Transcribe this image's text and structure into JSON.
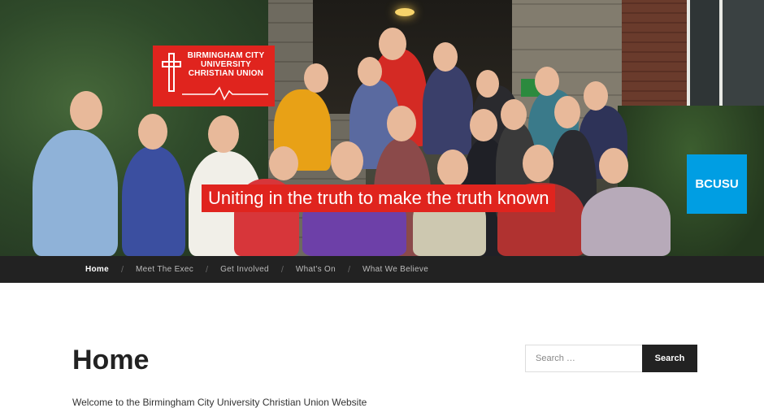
{
  "header": {
    "logo": {
      "lines": [
        "BIRMINGHAM CITY",
        "UNIVERSITY",
        "CHRISTIAN UNION"
      ],
      "background": "#e0241e"
    },
    "tagline": "Uniting in the truth to make the truth known",
    "bcusu_badge": "BCUSU",
    "brand_colors": {
      "red": "#e0241e",
      "blue": "#009ee3"
    }
  },
  "nav": {
    "items": [
      {
        "label": "Home",
        "active": true
      },
      {
        "label": "Meet The Exec",
        "active": false
      },
      {
        "label": "Get Involved",
        "active": false
      },
      {
        "label": "What's On",
        "active": false
      },
      {
        "label": "What We Believe",
        "active": false
      }
    ],
    "separator": "/"
  },
  "main": {
    "title": "Home",
    "intro": "Welcome to the Birmingham City University Christian Union Website"
  },
  "sidebar": {
    "search": {
      "placeholder": "Search …",
      "button_label": "Search"
    }
  }
}
